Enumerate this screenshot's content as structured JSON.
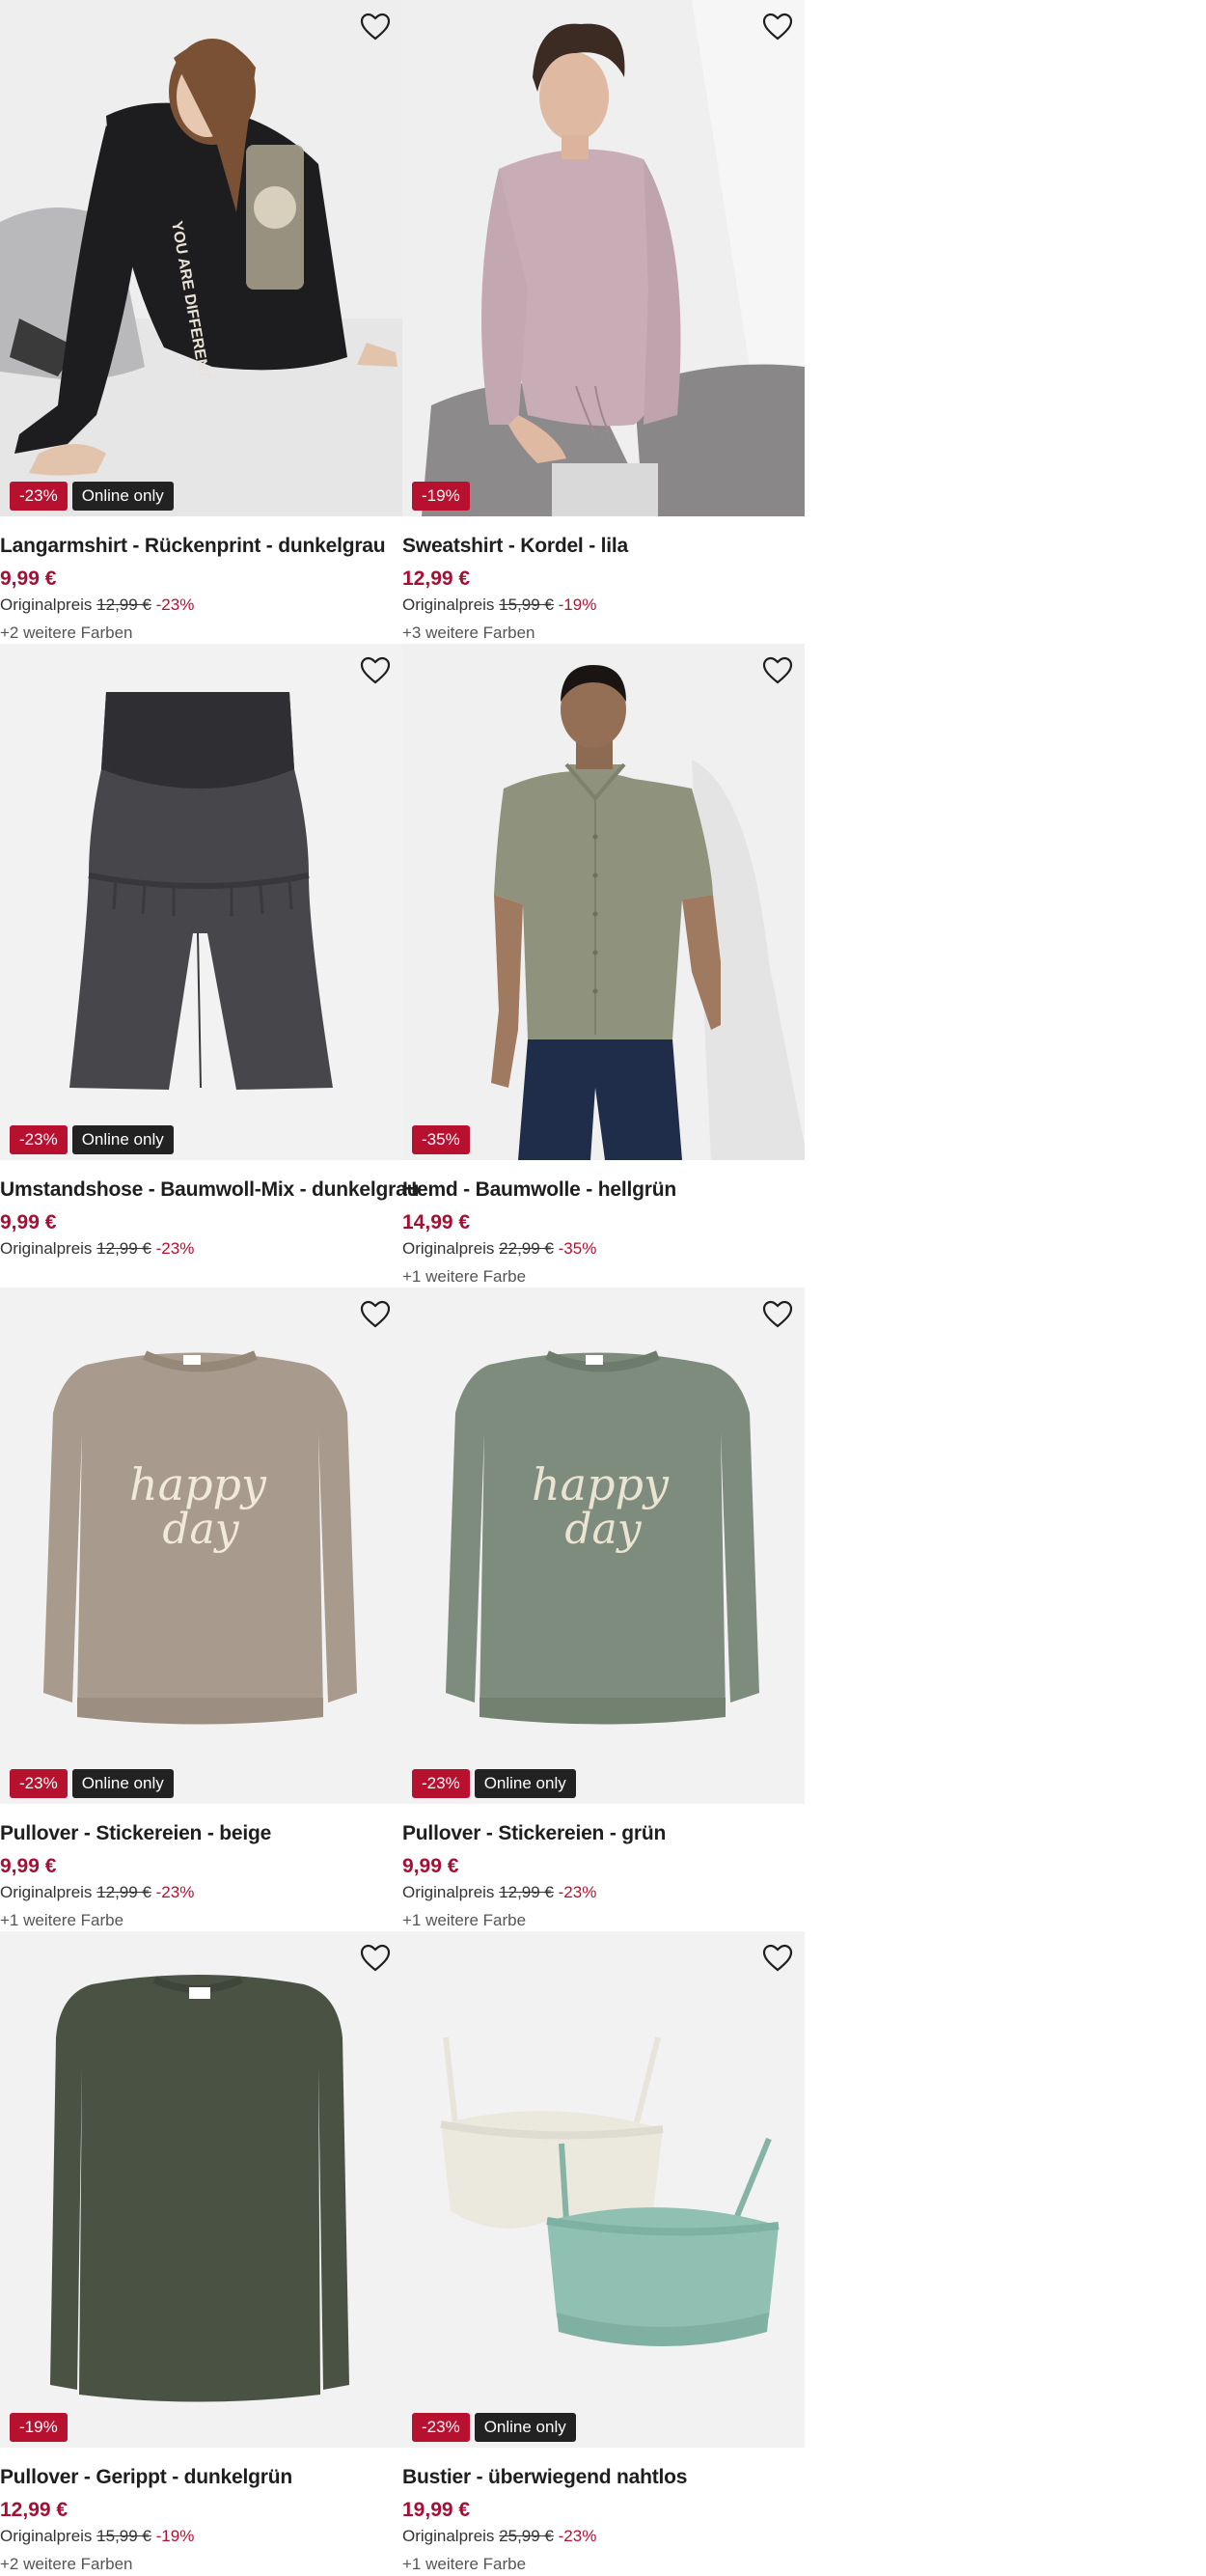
{
  "products": [
    {
      "title": "Langarmshirt - Rückenprint - dunkelgrau",
      "price": "9,99 €",
      "orig_label": "Originalpreis",
      "orig_price": "12,99 €",
      "discount": "-23%",
      "badges": {
        "sale": "-23%",
        "online": "Online only"
      },
      "colors": "+2 weitere Farben",
      "image": "longsleeve-shirt-model"
    },
    {
      "title": "Sweatshirt - Kordel - lila",
      "price": "12,99 €",
      "orig_label": "Originalpreis",
      "orig_price": "15,99 €",
      "discount": "-19%",
      "badges": {
        "sale": "-19%"
      },
      "colors": "+3 weitere Farben",
      "image": "sweatshirt-model"
    },
    {
      "title": "Umstandshose - Baumwoll-Mix - dunkelgrau",
      "price": "9,99 €",
      "orig_label": "Originalpreis",
      "orig_price": "12,99 €",
      "discount": "-23%",
      "badges": {
        "sale": "-23%",
        "online": "Online only"
      },
      "colors": "",
      "image": "maternity-shorts"
    },
    {
      "title": "Hemd - Baumwolle - hellgrün",
      "price": "14,99 €",
      "orig_label": "Originalpreis",
      "orig_price": "22,99 €",
      "discount": "-35%",
      "badges": {
        "sale": "-35%"
      },
      "colors": "+1 weitere Farbe",
      "image": "shirt-model"
    },
    {
      "title": "Pullover - Stickereien - beige",
      "price": "9,99 €",
      "orig_label": "Originalpreis",
      "orig_price": "12,99 €",
      "discount": "-23%",
      "badges": {
        "sale": "-23%",
        "online": "Online only"
      },
      "colors": "+1 weitere Farbe",
      "image": "sweater-beige"
    },
    {
      "title": "Pullover - Stickereien - grün",
      "price": "9,99 €",
      "orig_label": "Originalpreis",
      "orig_price": "12,99 €",
      "discount": "-23%",
      "badges": {
        "sale": "-23%",
        "online": "Online only"
      },
      "colors": "+1 weitere Farbe",
      "image": "sweater-green"
    },
    {
      "title": "Pullover - Gerippt - dunkelgrün",
      "price": "12,99 €",
      "orig_label": "Originalpreis",
      "orig_price": "15,99 €",
      "discount": "-19%",
      "badges": {
        "sale": "-19%"
      },
      "colors": "+2 weitere Farben",
      "image": "sweater-darkgreen"
    },
    {
      "title": "Bustier - überwiegend nahtlos",
      "price": "19,99 €",
      "orig_label": "Originalpreis",
      "orig_price": "25,99 €",
      "discount": "-23%",
      "badges": {
        "sale": "-23%",
        "online": "Online only"
      },
      "colors": "+1 weitere Farbe",
      "image": "bustier-set"
    }
  ],
  "happy_text": {
    "line1": "happy",
    "line2": "day"
  },
  "colors": {
    "price": "#a50f33",
    "sale_badge": "#b8102f",
    "online_badge": "#222222",
    "image_bg": "#f2f2f2"
  },
  "icons": {
    "wishlist": "heart-outline-icon"
  }
}
